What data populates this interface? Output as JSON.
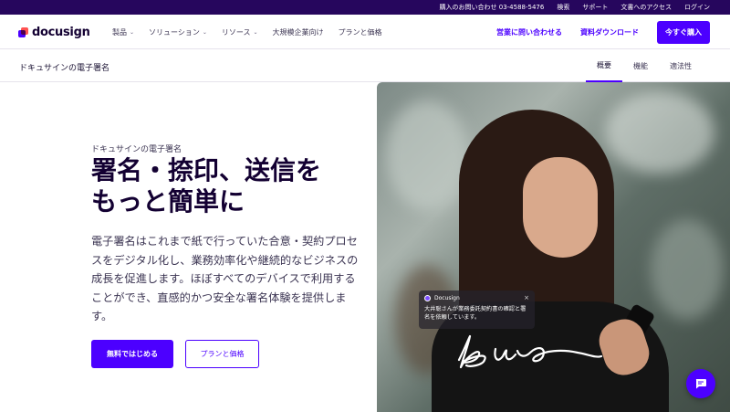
{
  "topbar": {
    "links": [
      "購入のお問い合わせ 03-4588-5476",
      "検索",
      "サポート",
      "文書へのアクセス",
      "ログイン"
    ]
  },
  "nav": {
    "logo_text": "docusign",
    "menu": [
      {
        "label": "製品",
        "has_dropdown": true
      },
      {
        "label": "ソリューション",
        "has_dropdown": true
      },
      {
        "label": "リソース",
        "has_dropdown": true
      },
      {
        "label": "大規模企業向け",
        "has_dropdown": false
      },
      {
        "label": "プランと価格",
        "has_dropdown": false
      }
    ],
    "contact_sales": "営業に問い合わせる",
    "download": "資料ダウンロード",
    "buy_now": "今すぐ購入"
  },
  "subnav": {
    "title": "ドキュサインの電子署名",
    "tabs": [
      "概要",
      "機能",
      "適法性"
    ],
    "active_tab": "概要"
  },
  "hero": {
    "eyebrow": "ドキュサインの電子署名",
    "title_line1": "署名・捺印、送信を",
    "title_line2": "もっと簡単に",
    "body": "電子署名はこれまで紙で行っていた合意・契約プロセスをデジタル化し、業務効率化や継続的なビジネスの成長を促進します。ほぼすべてのデバイスで利用することができ、直感的かつ安全な署名体験を提供します。",
    "primary_cta": "無料ではじめる",
    "secondary_cta": "プランと価格"
  },
  "notification": {
    "brand": "Docusign",
    "close": "×",
    "message": "大井聡さんが業務委託契約書の確認と署名を依頼しています。"
  },
  "icons": {
    "chevron": "chevron-down-icon",
    "chat": "chat-icon",
    "close": "close-icon"
  },
  "colors": {
    "brand_purple": "#4c00ff",
    "topbar_bg": "#26065d",
    "heading": "#130032"
  }
}
